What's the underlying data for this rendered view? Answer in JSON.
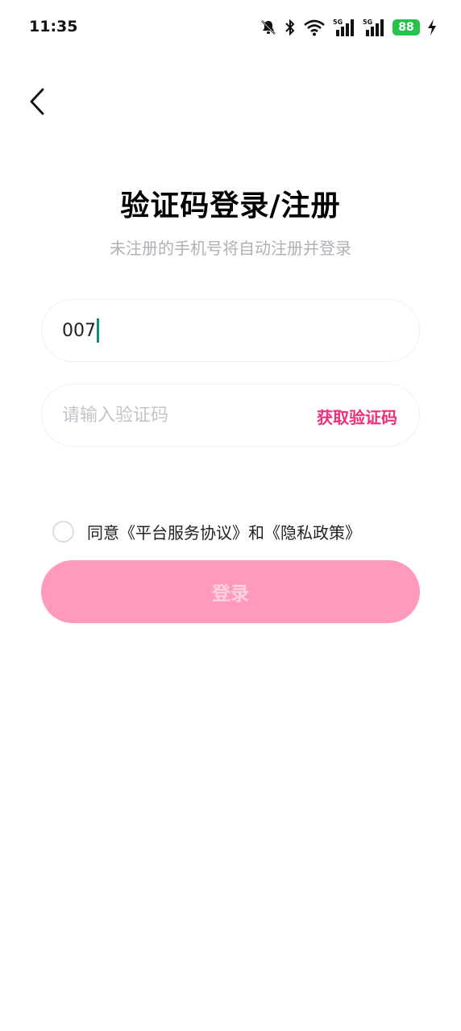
{
  "status_bar": {
    "time": "11:35",
    "icons": [
      "bell-muted-icon",
      "bluetooth-icon",
      "wifi-icon",
      "signal-5g-icon",
      "signal-5g-icon",
      "battery-icon",
      "charging-icon"
    ],
    "signal_label_1": "5G",
    "signal_label_2": "5G",
    "battery_level": "88",
    "battery_color": "#27c24c"
  },
  "header": {
    "back_icon": "chevron-left-icon",
    "title": "验证码登录/注册",
    "subtitle": "未注册的手机号将自动注册并登录"
  },
  "form": {
    "phone_value": "007",
    "code_placeholder": "请输入验证码",
    "get_code_label": "获取验证码"
  },
  "agreement": {
    "checked": false,
    "prefix": "同意",
    "terms_link": "《平台服务协议》",
    "joiner": "和",
    "privacy_link": "《隐私政策》"
  },
  "login": {
    "label": "登录"
  },
  "colors": {
    "accent": "#ef2f79",
    "login_bg": "#ff99bd",
    "login_text": "#ffd1e1",
    "caret": "#0c8f7e"
  }
}
